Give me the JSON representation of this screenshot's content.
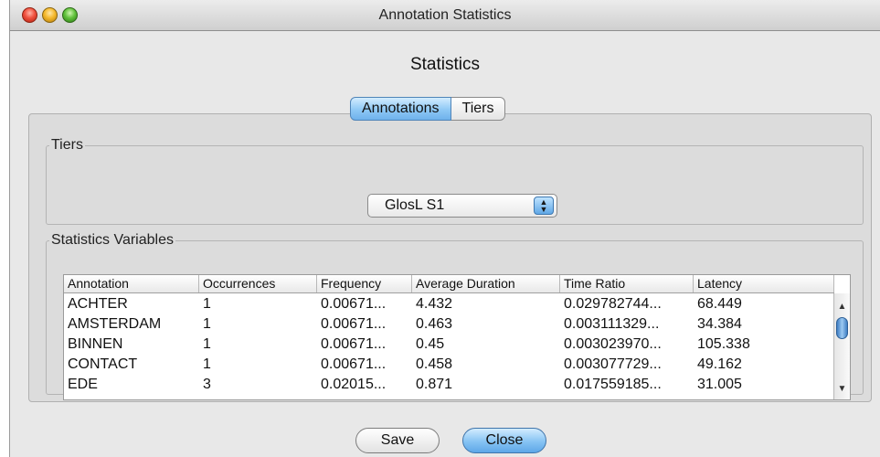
{
  "window": {
    "title": "Annotation Statistics"
  },
  "dialog": {
    "heading": "Statistics"
  },
  "tabs": [
    {
      "label": "Annotations",
      "selected": true
    },
    {
      "label": "Tiers",
      "selected": false
    }
  ],
  "tiers_group": {
    "legend": "Tiers",
    "selected_tier": "GlosL S1"
  },
  "stats_group": {
    "legend": "Statistics Variables",
    "columns": [
      "Annotation",
      "Occurrences",
      "Frequency",
      "Average Duration",
      "Time Ratio",
      "Latency"
    ],
    "rows": [
      [
        "ACHTER",
        "1",
        "0.00671...",
        "4.432",
        "0.029782744...",
        "68.449"
      ],
      [
        "AMSTERDAM",
        "1",
        "0.00671...",
        "0.463",
        "0.003111329...",
        "34.384"
      ],
      [
        "BINNEN",
        "1",
        "0.00671...",
        "0.45",
        "0.003023970...",
        "105.338"
      ],
      [
        "CONTACT",
        "1",
        "0.00671...",
        "0.458",
        "0.003077729...",
        "49.162"
      ],
      [
        "EDE",
        "3",
        "0.02015...",
        "0.871",
        "0.017559185...",
        "31.005"
      ]
    ]
  },
  "buttons": {
    "save": "Save",
    "close": "Close"
  },
  "colors": {
    "accent": "#8ec8f5",
    "window_bg": "#e8e8e8"
  }
}
